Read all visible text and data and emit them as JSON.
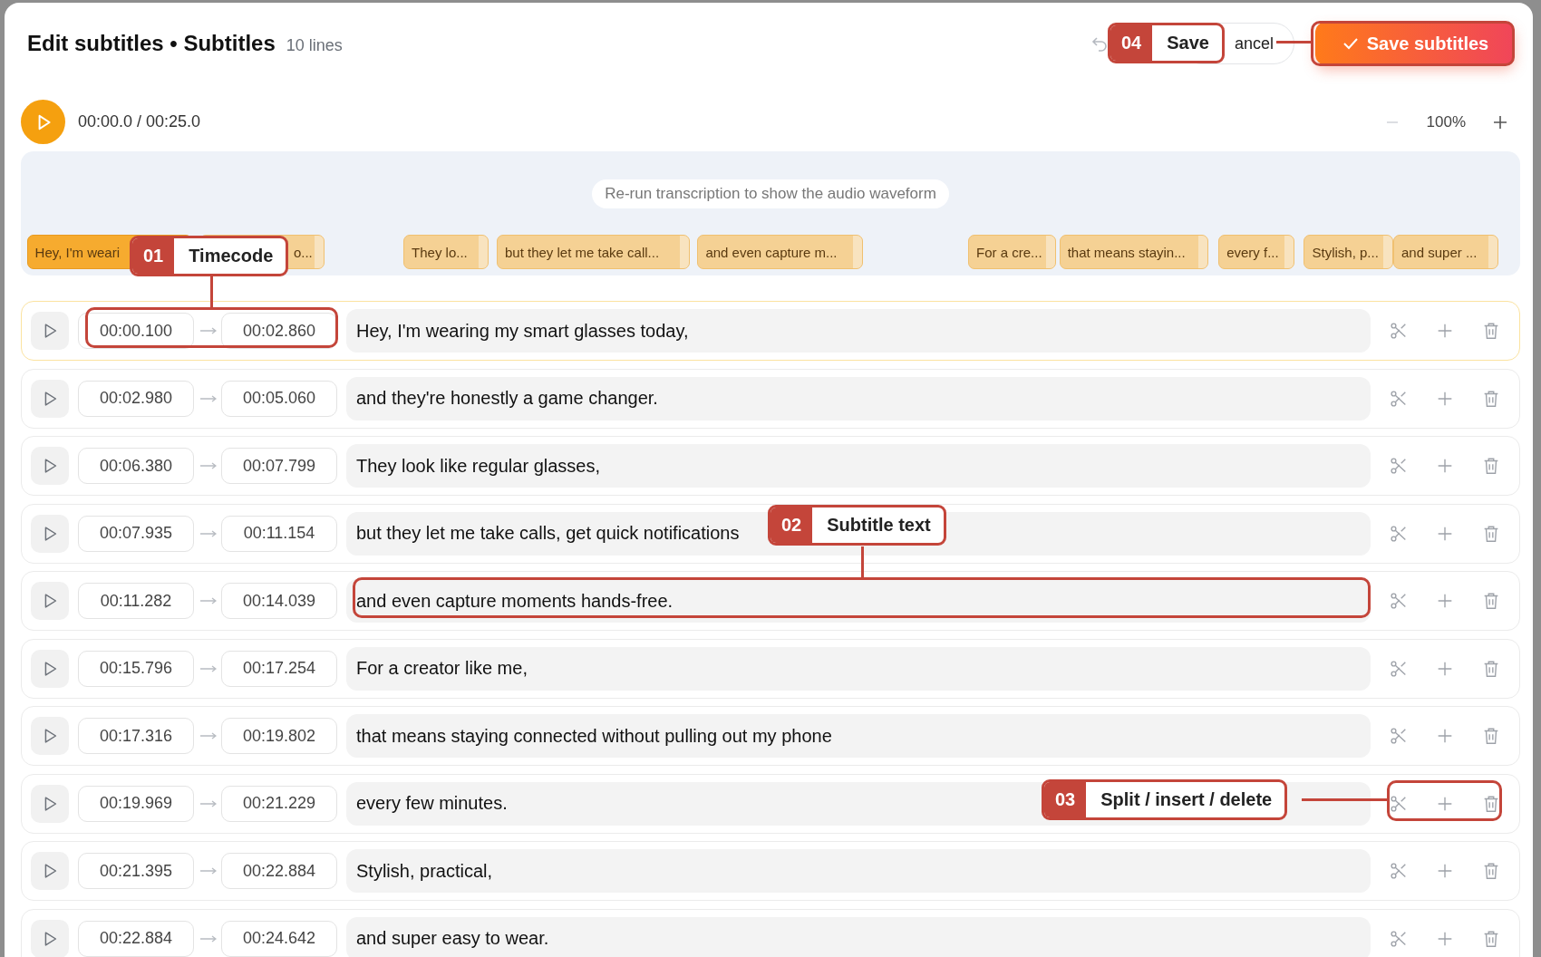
{
  "window": {
    "title": "Edit subtitles • Subtitles",
    "line_count": "10 lines"
  },
  "header": {
    "cancel": "ancel",
    "save": "Save subtitles"
  },
  "player": {
    "time": "00:00.0 / 00:25.0",
    "zoom": "100%"
  },
  "timeline": {
    "hint": "Re-run transcription to show the audio waveform",
    "chips": [
      {
        "label": "Hey, I'm weari",
        "selected": true
      },
      {
        "label": "o...",
        "selected": false
      },
      {
        "label": "They lo...",
        "selected": false
      },
      {
        "label": "but they let me take call...",
        "selected": false
      },
      {
        "label": "and even capture m...",
        "selected": false
      },
      {
        "label": "For a cre...",
        "selected": false
      },
      {
        "label": "that means stayin...",
        "selected": false
      },
      {
        "label": "every f...",
        "selected": false
      },
      {
        "label": "Stylish, p...",
        "selected": false
      },
      {
        "label": "and super ...",
        "selected": false
      }
    ]
  },
  "rows": [
    {
      "start": "00:00.100",
      "end": "00:02.860",
      "text": "Hey, I'm wearing my smart glasses today,",
      "selected": true
    },
    {
      "start": "00:02.980",
      "end": "00:05.060",
      "text": "and they're honestly a game changer.",
      "selected": false
    },
    {
      "start": "00:06.380",
      "end": "00:07.799",
      "text": "They look like regular glasses,",
      "selected": false
    },
    {
      "start": "00:07.935",
      "end": "00:11.154",
      "text": "but they let me take calls, get quick notifications",
      "selected": false
    },
    {
      "start": "00:11.282",
      "end": "00:14.039",
      "text": "and even capture moments hands-free.",
      "selected": false
    },
    {
      "start": "00:15.796",
      "end": "00:17.254",
      "text": "For a creator like me,",
      "selected": false
    },
    {
      "start": "00:17.316",
      "end": "00:19.802",
      "text": "that means staying connected without pulling out my phone",
      "selected": false
    },
    {
      "start": "00:19.969",
      "end": "00:21.229",
      "text": "every few minutes.",
      "selected": false
    },
    {
      "start": "00:21.395",
      "end": "00:22.884",
      "text": "Stylish, practical,",
      "selected": false
    },
    {
      "start": "00:22.884",
      "end": "00:24.642",
      "text": "and super easy to wear.",
      "selected": false
    }
  ],
  "callouts": [
    {
      "number": "04",
      "label": "Save"
    },
    {
      "number": "01",
      "label": "Timecode"
    },
    {
      "number": "02",
      "label": "Subtitle text"
    },
    {
      "number": "03",
      "label": "Split / insert / delete"
    }
  ]
}
